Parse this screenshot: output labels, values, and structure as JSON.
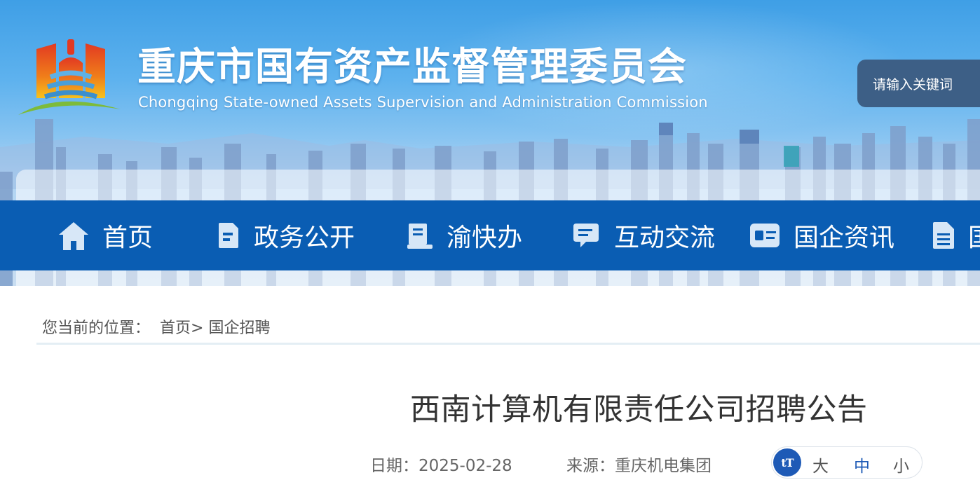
{
  "header": {
    "title": "重庆市国有资产监督管理委员会",
    "subtitle": "Chongqing State-owned Assets Supervision and Administration Commission",
    "search_placeholder": "请输入关键词"
  },
  "nav": {
    "items": [
      {
        "label": "首页",
        "icon": "home-icon"
      },
      {
        "label": "政务公开",
        "icon": "document-icon"
      },
      {
        "label": "渝快办",
        "icon": "book-icon"
      },
      {
        "label": "互动交流",
        "icon": "chat-icon"
      },
      {
        "label": "国企资讯",
        "icon": "news-card-icon"
      },
      {
        "label": "国",
        "icon": "file-icon"
      }
    ]
  },
  "breadcrumb": {
    "prefix": "您当前的位置：",
    "items": [
      "首页",
      "国企招聘"
    ],
    "separator": ">"
  },
  "article": {
    "title": "西南计算机有限责任公司招聘公告",
    "date_label": "日期：",
    "date": "2025-02-28",
    "source_label": "来源：",
    "source": "重庆机电集团",
    "font_size": {
      "icon_text": "tT",
      "large": "大",
      "medium": "中",
      "small": "小"
    }
  },
  "colors": {
    "nav_bg": "#0a5db3",
    "search_bg": "#3d5f86",
    "font_icon_bg": "#1e5ab6",
    "active_size": "#1e5ab6"
  }
}
